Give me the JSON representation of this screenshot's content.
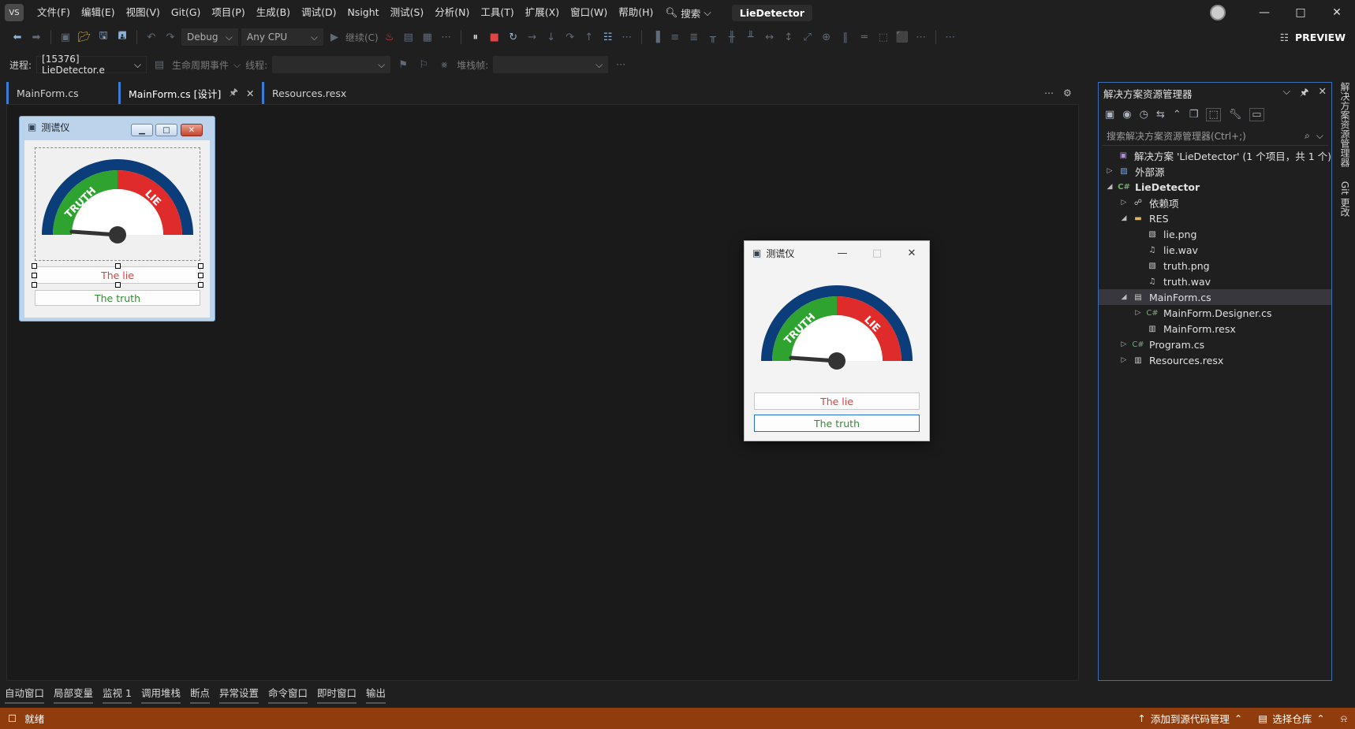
{
  "menu": {
    "items": [
      "文件(F)",
      "编辑(E)",
      "视图(V)",
      "Git(G)",
      "项目(P)",
      "生成(B)",
      "调试(D)",
      "Nsight",
      "测试(S)",
      "分析(N)",
      "工具(T)",
      "扩展(X)",
      "窗口(W)",
      "帮助(H)"
    ],
    "search_label": "搜索",
    "solution_name": "LieDetector"
  },
  "toolbar": {
    "config": "Debug",
    "platform": "Any CPU",
    "continue_label": "继续(C)",
    "preview_label": "PREVIEW"
  },
  "debug_bar": {
    "process_label": "进程:",
    "process_value": "[15376] LieDetector.e",
    "lifecycle_label": "生命周期事件",
    "thread_label": "线程:",
    "stackframe_label": "堆栈帧:"
  },
  "tabs": [
    {
      "label": "MainForm.cs"
    },
    {
      "label": "MainForm.cs [设计]"
    },
    {
      "label": "Resources.resx"
    }
  ],
  "designer_form": {
    "title": "测谎仪",
    "lie_button": "The lie",
    "truth_button": "The truth"
  },
  "running_form": {
    "title": "测谎仪",
    "lie_button": "The lie",
    "truth_button": "The truth"
  },
  "gauge": {
    "truth_text": "TRUTH",
    "lie_text": "LIE",
    "colors": {
      "truth": "#2fa32f",
      "lie": "#e02b2b",
      "rim": "#0b3d7a",
      "needle": "#333333"
    }
  },
  "solution_explorer": {
    "title": "解决方案资源管理器",
    "search_placeholder": "搜索解决方案资源管理器(Ctrl+;)",
    "tree": [
      {
        "label": "解决方案 'LieDetector' (1 个项目，共 1 个)",
        "icon": "solution-icon"
      },
      {
        "label": "外部源",
        "icon": "external-icon"
      },
      {
        "label": "LieDetector",
        "icon": "csharp-project-icon"
      },
      {
        "label": "依赖项",
        "icon": "dependencies-icon"
      },
      {
        "label": "RES",
        "icon": "folder-icon"
      },
      {
        "label": "lie.png",
        "icon": "image-file-icon"
      },
      {
        "label": "lie.wav",
        "icon": "audio-file-icon"
      },
      {
        "label": "truth.png",
        "icon": "image-file-icon"
      },
      {
        "label": "truth.wav",
        "icon": "audio-file-icon"
      },
      {
        "label": "MainForm.cs",
        "icon": "form-icon"
      },
      {
        "label": "MainForm.Designer.cs",
        "icon": "csharp-file-icon"
      },
      {
        "label": "MainForm.resx",
        "icon": "resx-file-icon"
      },
      {
        "label": "Program.cs",
        "icon": "csharp-file-icon"
      },
      {
        "label": "Resources.resx",
        "icon": "resx-file-icon"
      }
    ],
    "side_tabs": [
      "解决方案资源管理器",
      "Git 更改"
    ]
  },
  "bottom_tabs": [
    "自动窗口",
    "局部变量",
    "监视 1",
    "调用堆栈",
    "断点",
    "异常设置",
    "命令窗口",
    "即时窗口",
    "输出"
  ],
  "status": {
    "ready": "就绪",
    "add_source_control": "添加到源代码管理",
    "select_repo": "选择仓库"
  },
  "colors": {
    "status_bar": "#913c0c",
    "accent": "#3a7bd5",
    "lie": "#e23b3b",
    "truth": "#2f8f2f"
  }
}
